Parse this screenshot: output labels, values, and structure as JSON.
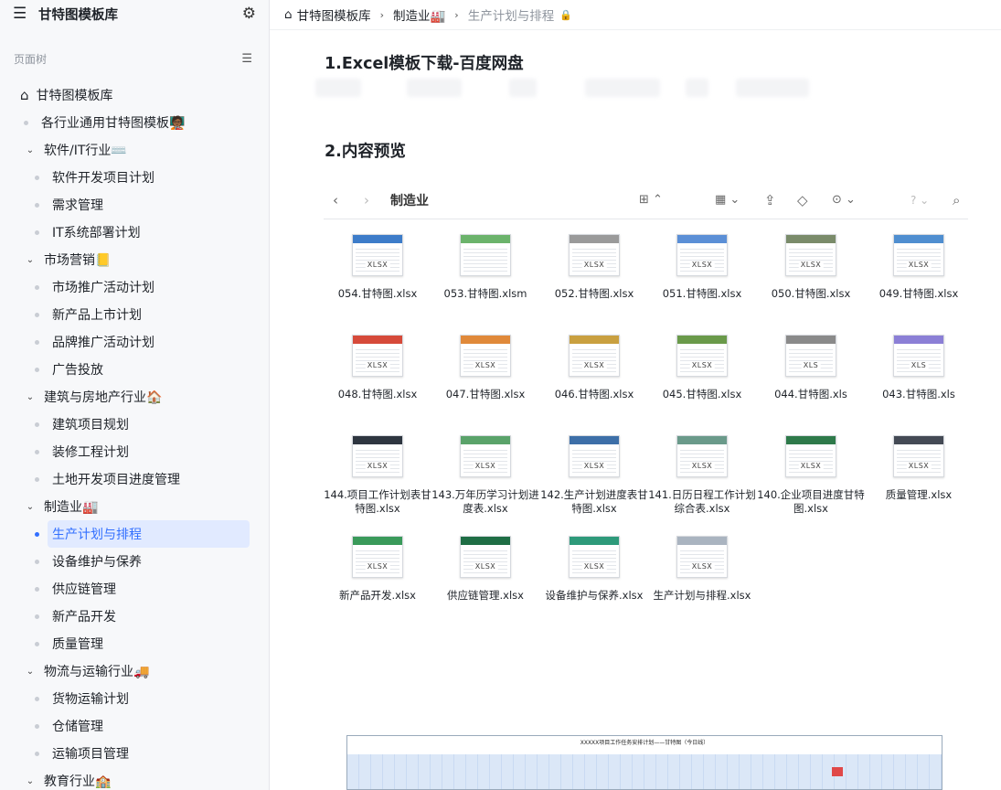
{
  "sidebar": {
    "title": "甘特图模板库",
    "tree_label": "页面树",
    "items": [
      {
        "label": "甘特图模板库",
        "level": 0,
        "kind": "home"
      },
      {
        "label": "各行业通用甘特图模板🧑🏾‍🏫",
        "level": 1,
        "kind": "leaf"
      },
      {
        "label": "软件/IT行业⌨️",
        "level": 1,
        "kind": "folder"
      },
      {
        "label": "软件开发项目计划",
        "level": 2,
        "kind": "leaf"
      },
      {
        "label": "需求管理",
        "level": 2,
        "kind": "leaf"
      },
      {
        "label": "IT系统部署计划",
        "level": 2,
        "kind": "leaf"
      },
      {
        "label": "市场营销📒",
        "level": 1,
        "kind": "folder"
      },
      {
        "label": "市场推广活动计划",
        "level": 2,
        "kind": "leaf"
      },
      {
        "label": "新产品上市计划",
        "level": 2,
        "kind": "leaf"
      },
      {
        "label": "品牌推广活动计划",
        "level": 2,
        "kind": "leaf"
      },
      {
        "label": "广告投放",
        "level": 2,
        "kind": "leaf"
      },
      {
        "label": "建筑与房地产行业🏠",
        "level": 1,
        "kind": "folder"
      },
      {
        "label": "建筑项目规划",
        "level": 2,
        "kind": "leaf"
      },
      {
        "label": "装修工程计划",
        "level": 2,
        "kind": "leaf"
      },
      {
        "label": "土地开发项目进度管理",
        "level": 2,
        "kind": "leaf"
      },
      {
        "label": "制造业🏭",
        "level": 1,
        "kind": "folder"
      },
      {
        "label": "生产计划与排程",
        "level": 2,
        "kind": "leaf",
        "active": true
      },
      {
        "label": "设备维护与保养",
        "level": 2,
        "kind": "leaf"
      },
      {
        "label": "供应链管理",
        "level": 2,
        "kind": "leaf"
      },
      {
        "label": "新产品开发",
        "level": 2,
        "kind": "leaf"
      },
      {
        "label": "质量管理",
        "level": 2,
        "kind": "leaf"
      },
      {
        "label": "物流与运输行业🚚",
        "level": 1,
        "kind": "folder"
      },
      {
        "label": "货物运输计划",
        "level": 2,
        "kind": "leaf"
      },
      {
        "label": "仓储管理",
        "level": 2,
        "kind": "leaf"
      },
      {
        "label": "运输项目管理",
        "level": 2,
        "kind": "leaf"
      },
      {
        "label": "教育行业🏫",
        "level": 1,
        "kind": "folder"
      }
    ]
  },
  "breadcrumb": {
    "items": [
      "甘特图模板库",
      "制造业🏭",
      "生产计划与排程"
    ]
  },
  "main": {
    "heading1": "1.Excel模板下载-百度网盘",
    "heading2": "2.内容预览",
    "finder": {
      "title": "制造业",
      "files": [
        {
          "name": "054.甘特图.xlsx",
          "tag": "XLSX",
          "color": "#3d7cc9"
        },
        {
          "name": "053.甘特图.xlsm",
          "tag": "",
          "color": "#6bb36b"
        },
        {
          "name": "052.甘特图.xlsx",
          "tag": "XLSX",
          "color": "#9a9a9a"
        },
        {
          "name": "051.甘特图.xlsx",
          "tag": "XLSX",
          "color": "#5b8fd6"
        },
        {
          "name": "050.甘特图.xlsx",
          "tag": "XLSX",
          "color": "#7a8b6a"
        },
        {
          "name": "049.甘特图.xlsx",
          "tag": "XLSX",
          "color": "#4f8ed0"
        },
        {
          "name": "048.甘特图.xlsx",
          "tag": "XLSX",
          "color": "#d64a3a"
        },
        {
          "name": "047.甘特图.xlsx",
          "tag": "XLSX",
          "color": "#e0893a"
        },
        {
          "name": "046.甘特图.xlsx",
          "tag": "XLSX",
          "color": "#c9a040"
        },
        {
          "name": "045.甘特图.xlsx",
          "tag": "XLSX",
          "color": "#6a9a4a"
        },
        {
          "name": "044.甘特图.xls",
          "tag": "XLS",
          "color": "#8a8a8a"
        },
        {
          "name": "043.甘特图.xls",
          "tag": "XLS",
          "color": "#8b7fd6"
        },
        {
          "name": "144.项目工作计划表甘特图.xlsx",
          "tag": "XLSX",
          "color": "#2e3640"
        },
        {
          "name": "143.万年历学习计划进度表.xlsx",
          "tag": "XLSX",
          "color": "#5aa36a"
        },
        {
          "name": "142.生产计划进度表甘特图.xlsx",
          "tag": "XLSX",
          "color": "#3d6fa8"
        },
        {
          "name": "141.日历日程工作计划综合表.xlsx",
          "tag": "XLSX",
          "color": "#6a9a8a"
        },
        {
          "name": "140.企业项目进度甘特图.xlsx",
          "tag": "XLSX",
          "color": "#2e7a4a"
        },
        {
          "name": "质量管理.xlsx",
          "tag": "XLSX",
          "color": "#444a55"
        },
        {
          "name": "新产品开发.xlsx",
          "tag": "XLSX",
          "color": "#3a9a5a"
        },
        {
          "name": "供应链管理.xlsx",
          "tag": "XLSX",
          "color": "#1f6e45"
        },
        {
          "name": "设备维护与保养.xlsx",
          "tag": "XLSX",
          "color": "#2e9a7a"
        },
        {
          "name": "生产计划与排程.xlsx",
          "tag": "XLSX",
          "color": "#aab4c0"
        }
      ]
    },
    "preview_title": "XXXXX项目工作任务安排计划——甘特图（今日线）"
  },
  "colors": {
    "accent": "#3370ff",
    "active_bg": "#e1eaff"
  }
}
